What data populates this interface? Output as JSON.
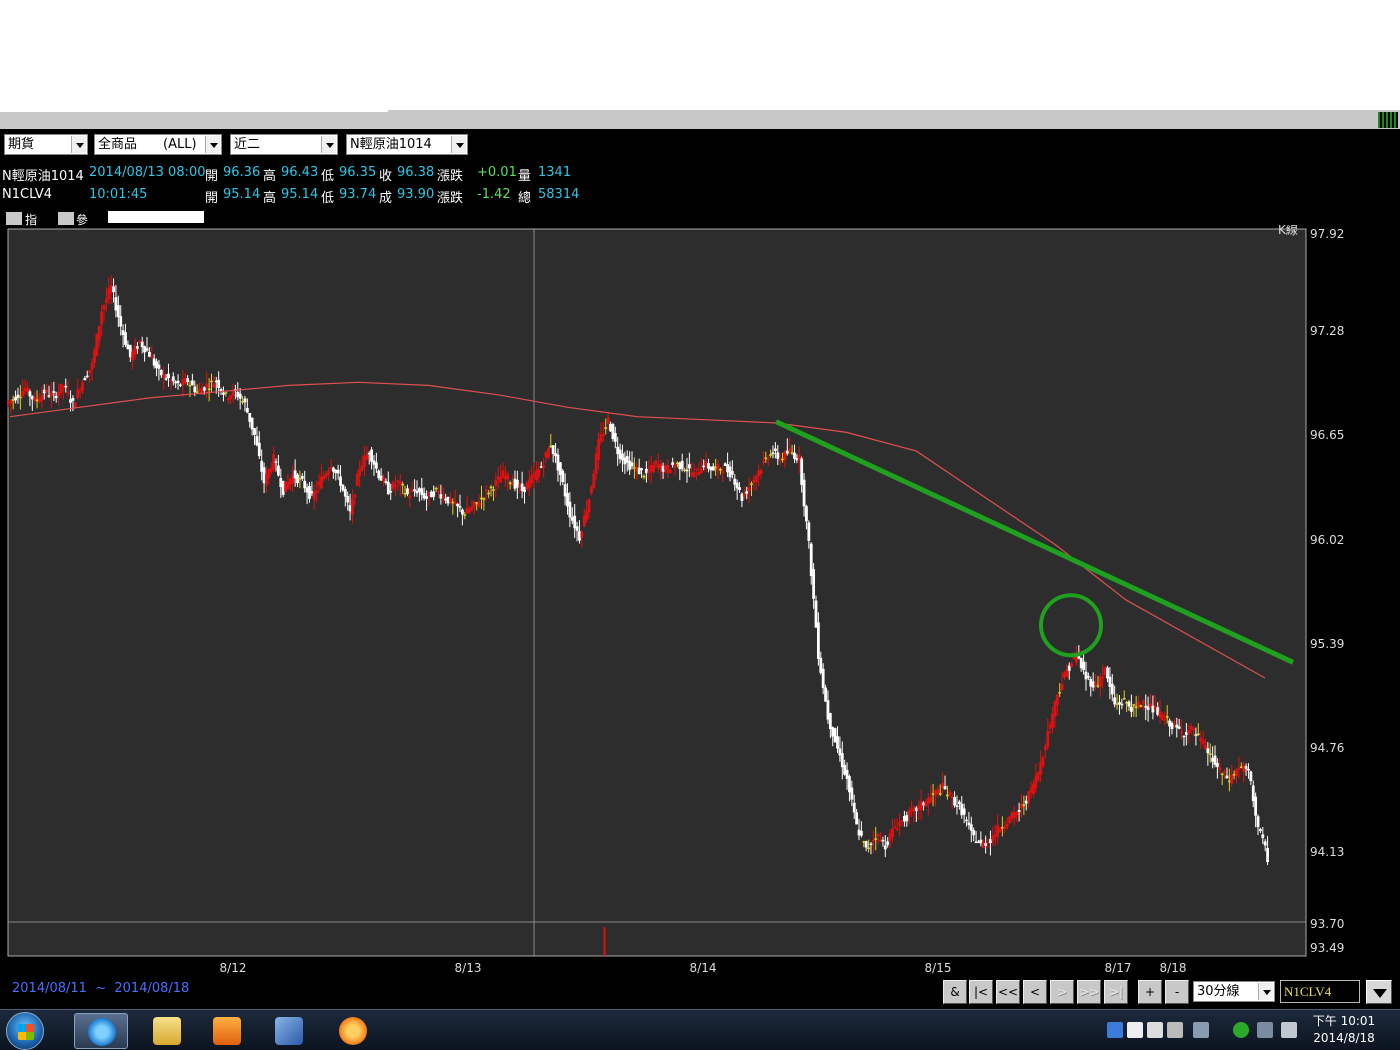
{
  "toolbar": {
    "market_select": "期貨",
    "product_select": "全商品　　(ALL)",
    "month_select": "近二",
    "contract_select": "N輕原油1014"
  },
  "quotes": [
    {
      "name": "N輕原油1014",
      "time": "2014/08/13 08:00",
      "open_label": "開",
      "open": "96.36",
      "high_label": "高",
      "high": "96.43",
      "low_label": "低",
      "low": "96.35",
      "close_label": "收",
      "close": "96.38",
      "chg_label": "漲跌",
      "chg": "+0.01",
      "vol_label": "量",
      "vol": "1341"
    },
    {
      "name": "N1CLV4",
      "time": "10:01:45",
      "open_label": "開",
      "open": "95.14",
      "high_label": "高",
      "high": "95.14",
      "low_label": "低",
      "low": "93.74",
      "close_label": "成",
      "close": "93.90",
      "chg_label": "漲跌",
      "chg": "-1.42",
      "vol_label": "總",
      "vol": "58314"
    }
  ],
  "indicator_bar": {
    "indicator_label": "指標",
    "param_label": "參數"
  },
  "chart_data": {
    "type": "candlestick",
    "title": "K線",
    "ylim": [
      93.49,
      97.92
    ],
    "y_ticks": [
      "97.92",
      "97.28",
      "96.65",
      "96.02",
      "95.39",
      "94.76",
      "94.13",
      "93.70",
      "93.49"
    ],
    "x_ticks": [
      "8/12",
      "8/13",
      "8/14",
      "8/15",
      "8/17",
      "8/18"
    ],
    "grid": false,
    "series": [
      {
        "kind": "price_path",
        "close": [
          96.85,
          96.9,
          96.82,
          96.88,
          96.85,
          96.92,
          96.8,
          96.95,
          97.05,
          97.4,
          97.55,
          97.3,
          97.1,
          97.2,
          97.12,
          97.0,
          96.96,
          96.92,
          96.95,
          96.88,
          96.92,
          96.95,
          96.85,
          96.88,
          96.8,
          96.6,
          96.3,
          96.45,
          96.25,
          96.35,
          96.3,
          96.2,
          96.32,
          96.42,
          96.3,
          96.1,
          96.4,
          96.5,
          96.35,
          96.25,
          96.3,
          96.22,
          96.25,
          96.2,
          96.25,
          96.2,
          96.15,
          96.1,
          96.15,
          96.22,
          96.28,
          96.35,
          96.3,
          96.25,
          96.32,
          96.4,
          96.55,
          96.35,
          96.1,
          95.95,
          96.2,
          96.55,
          96.7,
          96.5,
          96.42,
          96.38,
          96.35,
          96.42,
          96.38,
          96.42,
          96.4,
          96.35,
          96.42,
          96.38,
          96.4,
          96.35,
          96.2,
          96.3,
          96.4,
          96.5,
          96.45,
          96.5,
          96.45,
          95.9,
          95.2,
          94.8,
          94.6,
          94.4,
          94.1,
          93.95,
          94.05,
          93.98,
          94.1,
          94.15,
          94.2,
          94.25,
          94.3,
          94.35,
          94.28,
          94.2,
          94.05,
          93.98,
          94.02,
          94.1,
          94.15,
          94.2,
          94.3,
          94.45,
          94.7,
          94.95,
          95.1,
          95.2,
          95.05,
          95.0,
          95.1,
          94.88,
          94.9,
          94.85,
          94.9,
          94.85,
          94.8,
          94.75,
          94.7,
          94.72,
          94.65,
          94.55,
          94.45,
          94.4,
          94.48,
          94.45,
          94.1,
          93.9
        ]
      },
      {
        "kind": "moving_average",
        "color": "#e05050",
        "values": [
          96.72,
          96.78,
          96.84,
          96.88,
          96.92,
          96.94,
          96.92,
          96.86,
          96.78,
          96.72,
          96.7,
          96.68,
          96.62,
          96.5,
          96.2,
          95.9,
          95.55,
          95.3,
          95.05
        ]
      }
    ],
    "volume_spike_at_index": 62,
    "annotations": [
      {
        "kind": "trendline",
        "color": "#1fa01f"
      },
      {
        "kind": "circle",
        "color": "#1fa01f"
      }
    ],
    "colors": {
      "up": "#e01010",
      "down": "#ffffff",
      "doji": "#e0d020",
      "background": "#2d2d2d"
    }
  },
  "bottombar": {
    "date_from": "2014/08/11",
    "date_sep": "~",
    "date_to": "2014/08/18",
    "nav_buttons": [
      "&",
      "|<",
      "<<",
      "<",
      ">",
      ">>",
      ">|",
      "+",
      "-"
    ],
    "period_select": "30分線",
    "symbol_input": "N1CLV4"
  },
  "taskbar": {
    "apps": [
      "internet-explorer-icon",
      "file-explorer-icon",
      "media-player-icon",
      "paint-icon",
      "chat-app-icon"
    ],
    "clock_time": "下午 10:01",
    "clock_date": "2014/8/18"
  }
}
